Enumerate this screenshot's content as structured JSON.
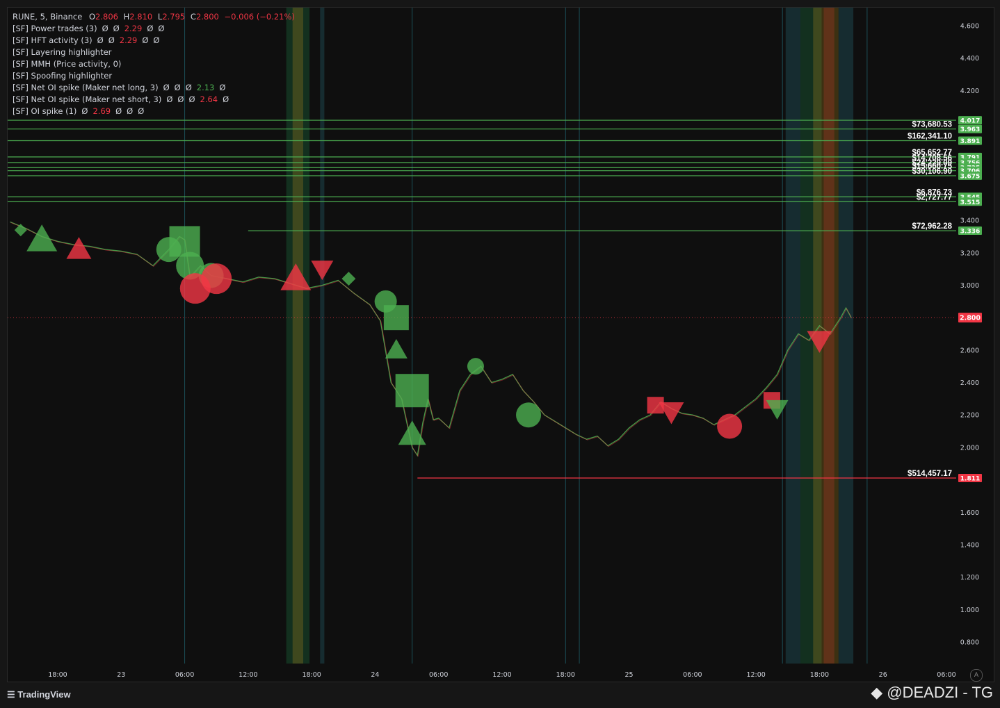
{
  "legend": {
    "symbol": "RUNE, 5, Binance",
    "o_label": "O",
    "o_val": "2.806",
    "h_label": "H",
    "h_val": "2.810",
    "l_label": "L",
    "l_val": "2.795",
    "c_label": "C",
    "c_val": "2.800",
    "change": "−0.006 (−0.21%)",
    "indicators": [
      {
        "name": "[SF] Power trades (3)",
        "parts": [
          [
            "Ø",
            "n"
          ],
          [
            "Ø",
            "n"
          ],
          [
            "2.29",
            "r"
          ],
          [
            "Ø",
            "n"
          ],
          [
            "Ø",
            "n"
          ]
        ]
      },
      {
        "name": "[SF] HFT activity (3)",
        "parts": [
          [
            "Ø",
            "n"
          ],
          [
            "Ø",
            "n"
          ],
          [
            "2.29",
            "r"
          ],
          [
            "Ø",
            "n"
          ],
          [
            "Ø",
            "n"
          ]
        ]
      },
      {
        "name": "[SF] Layering highlighter",
        "parts": []
      },
      {
        "name": "[SF] MMH (Price activity, 0)",
        "parts": []
      },
      {
        "name": "[SF] Spoofing highlighter",
        "parts": []
      },
      {
        "name": "[SF] Net OI spike (Maker net long, 3)",
        "parts": [
          [
            "Ø",
            "n"
          ],
          [
            "Ø",
            "n"
          ],
          [
            "Ø",
            "n"
          ],
          [
            "2.13",
            "g"
          ],
          [
            "Ø",
            "n"
          ]
        ]
      },
      {
        "name": "[SF] Net OI spike (Maker net short, 3)",
        "parts": [
          [
            "Ø",
            "n"
          ],
          [
            "Ø",
            "n"
          ],
          [
            "Ø",
            "n"
          ],
          [
            "2.64",
            "r"
          ],
          [
            "Ø",
            "n"
          ]
        ]
      },
      {
        "name": "[SF] OI spike (1)",
        "parts": [
          [
            "Ø",
            "n"
          ],
          [
            "2.69",
            "r"
          ],
          [
            "Ø",
            "n"
          ],
          [
            "Ø",
            "n"
          ],
          [
            "Ø",
            "n"
          ]
        ]
      }
    ]
  },
  "chart_data": {
    "type": "line",
    "symbol": "RUNE",
    "interval": "5",
    "exchange": "Binance",
    "ylim": [
      0.7,
      4.75
    ],
    "y_ticks": [
      "4.600",
      "4.400",
      "4.200",
      "3.400",
      "3.200",
      "3.000",
      "2.600",
      "2.400",
      "2.200",
      "2.000",
      "1.600",
      "1.400",
      "1.200",
      "1.000",
      "0.800"
    ],
    "x_ticks": [
      {
        "label": "18:00",
        "t": -6
      },
      {
        "label": "23",
        "t": 0
      },
      {
        "label": "06:00",
        "t": 6
      },
      {
        "label": "12:00",
        "t": 12
      },
      {
        "label": "18:00",
        "t": 18
      },
      {
        "label": "24",
        "t": 24
      },
      {
        "label": "06:00",
        "t": 30
      },
      {
        "label": "12:00",
        "t": 36
      },
      {
        "label": "18:00",
        "t": 42
      },
      {
        "label": "25",
        "t": 48
      },
      {
        "label": "06:00",
        "t": 54
      },
      {
        "label": "12:00",
        "t": 60
      },
      {
        "label": "18:00",
        "t": 66
      },
      {
        "label": "26",
        "t": 72
      },
      {
        "label": "06:00",
        "t": 78
      }
    ],
    "price_series": {
      "t": [
        -10.5,
        -9,
        -7.5,
        -6,
        -4.5,
        -3,
        -1.5,
        0,
        1.5,
        3,
        4.5,
        5.5,
        6,
        6.5,
        7.5,
        8.5,
        10,
        11.5,
        13,
        14.5,
        16,
        17.5,
        19,
        20.5,
        22,
        23.5,
        24.5,
        25.5,
        26.5,
        27.5,
        28,
        28.5,
        29,
        29.5,
        30,
        31,
        32,
        33,
        34,
        35,
        36,
        37,
        38,
        39,
        40,
        41,
        42,
        43,
        44,
        45,
        46,
        47,
        48,
        49,
        50,
        51,
        52,
        53,
        54,
        55,
        56,
        57,
        58,
        59,
        60,
        61,
        62,
        63,
        64,
        65,
        66,
        67,
        68,
        68.5,
        69
      ],
      "close": [
        3.39,
        3.35,
        3.3,
        3.27,
        3.25,
        3.24,
        3.22,
        3.21,
        3.19,
        3.12,
        3.22,
        3.3,
        3.28,
        3.05,
        3.12,
        3.06,
        3.04,
        3.02,
        3.05,
        3.04,
        3.01,
        2.98,
        3.0,
        3.03,
        2.95,
        2.88,
        2.78,
        2.4,
        2.3,
        2.0,
        1.95,
        2.15,
        2.3,
        2.17,
        2.18,
        2.12,
        2.35,
        2.45,
        2.5,
        2.4,
        2.42,
        2.45,
        2.35,
        2.28,
        2.2,
        2.16,
        2.12,
        2.08,
        2.05,
        2.07,
        2.01,
        2.05,
        2.12,
        2.17,
        2.2,
        2.28,
        2.24,
        2.21,
        2.2,
        2.18,
        2.14,
        2.17,
        2.2,
        2.25,
        2.3,
        2.37,
        2.45,
        2.6,
        2.7,
        2.66,
        2.75,
        2.7,
        2.8,
        2.86,
        2.8
      ],
      "color": "#4caf50"
    },
    "current_price": {
      "value": 2.8,
      "label": "2.800",
      "color": "#f23645"
    },
    "levels": [
      {
        "price": 4.017,
        "label": "4.017",
        "amount": "",
        "color": "#4caf50",
        "t_start": null
      },
      {
        "price": 3.963,
        "label": "3.963",
        "amount": "$73,680.53",
        "color": "#4caf50",
        "t_start": null
      },
      {
        "price": 3.891,
        "label": "3.891",
        "amount": "$162,341.10",
        "color": "#4caf50",
        "t_start": null
      },
      {
        "price": 3.791,
        "label": "3.791",
        "amount": "$65,652.77",
        "color": "#4caf50",
        "t_start": null
      },
      {
        "price": 3.756,
        "label": "3.756",
        "amount": "$14,708.56",
        "color": "#4caf50",
        "t_start": null
      },
      {
        "price": 3.725,
        "label": "3.725",
        "amount": "$24,229.09",
        "color": "#4caf50",
        "t_start": null
      },
      {
        "price": 3.706,
        "label": "3.706",
        "amount": "$15,660.75",
        "color": "#4caf50",
        "t_start": null
      },
      {
        "price": 3.675,
        "label": "3.675",
        "amount": "$30,106.90",
        "color": "#4caf50",
        "t_start": null
      },
      {
        "price": 3.545,
        "label": "3.545",
        "amount": "$6,876.73",
        "color": "#4caf50",
        "t_start": null
      },
      {
        "price": 3.515,
        "label": "3.515",
        "amount": "$2,727.77",
        "color": "#4caf50",
        "t_start": null
      },
      {
        "price": 3.336,
        "label": "3.336",
        "amount": "$72,962.28",
        "color": "#4caf50",
        "t_start": 12
      },
      {
        "price": 1.811,
        "label": "1.811",
        "amount": "$514,457.17",
        "color": "#f23645",
        "t_start": 28
      }
    ],
    "markers": [
      {
        "shape": "diamond",
        "t": -9.5,
        "price": 3.34,
        "color": "#4caf50",
        "size": 9
      },
      {
        "shape": "triangle-up",
        "t": -7.5,
        "price": 3.28,
        "color": "#4caf50",
        "size": 22
      },
      {
        "shape": "triangle-up",
        "t": -4.0,
        "price": 3.22,
        "color": "#f23645",
        "size": 18
      },
      {
        "shape": "circle",
        "t": 4.5,
        "price": 3.22,
        "color": "#4caf50",
        "size": 18
      },
      {
        "shape": "square",
        "t": 6.0,
        "price": 3.27,
        "color": "#4caf50",
        "size": 22
      },
      {
        "shape": "circle",
        "t": 6.5,
        "price": 3.12,
        "color": "#4caf50",
        "size": 20
      },
      {
        "shape": "circle",
        "t": 8.5,
        "price": 3.06,
        "color": "#4caf50",
        "size": 18
      },
      {
        "shape": "circle",
        "t": 7.0,
        "price": 2.98,
        "color": "#f23645",
        "size": 22
      },
      {
        "shape": "circle",
        "t": 9.0,
        "price": 3.04,
        "color": "#f23645",
        "size": 22
      },
      {
        "shape": "triangle-up",
        "t": 16.5,
        "price": 3.04,
        "color": "#f23645",
        "size": 22
      },
      {
        "shape": "triangle-down",
        "t": 19.0,
        "price": 3.1,
        "color": "#f23645",
        "size": 16
      },
      {
        "shape": "diamond",
        "t": 21.5,
        "price": 3.04,
        "color": "#4caf50",
        "size": 10
      },
      {
        "shape": "circle",
        "t": 25.0,
        "price": 2.9,
        "color": "#4caf50",
        "size": 16
      },
      {
        "shape": "square",
        "t": 26.0,
        "price": 2.8,
        "color": "#4caf50",
        "size": 18
      },
      {
        "shape": "triangle-up",
        "t": 26.0,
        "price": 2.6,
        "color": "#4caf50",
        "size": 16
      },
      {
        "shape": "square",
        "t": 27.5,
        "price": 2.35,
        "color": "#4caf50",
        "size": 24
      },
      {
        "shape": "triangle-up",
        "t": 27.5,
        "price": 2.08,
        "color": "#4caf50",
        "size": 20
      },
      {
        "shape": "circle",
        "t": 33.5,
        "price": 2.5,
        "color": "#4caf50",
        "size": 12
      },
      {
        "shape": "circle",
        "t": 38.5,
        "price": 2.2,
        "color": "#4caf50",
        "size": 18
      },
      {
        "shape": "square",
        "t": 50.5,
        "price": 2.26,
        "color": "#f23645",
        "size": 12
      },
      {
        "shape": "triangle-down",
        "t": 52.0,
        "price": 2.22,
        "color": "#f23645",
        "size": 18
      },
      {
        "shape": "circle",
        "t": 57.5,
        "price": 2.13,
        "color": "#f23645",
        "size": 18
      },
      {
        "shape": "square",
        "t": 61.5,
        "price": 2.29,
        "color": "#f23645",
        "size": 12
      },
      {
        "shape": "triangle-down",
        "t": 62.0,
        "price": 2.24,
        "color": "#4caf50",
        "size": 16
      },
      {
        "shape": "triangle-down",
        "t": 66.0,
        "price": 2.66,
        "color": "#f23645",
        "size": 18
      }
    ],
    "bands": [
      {
        "t0": 15.6,
        "t1": 17.8,
        "color": "#1f8a4c"
      },
      {
        "t0": 16.2,
        "t1": 17.2,
        "color": "#b58a1e"
      },
      {
        "t0": 18.8,
        "t1": 19.2,
        "color": "#2a7a8a"
      },
      {
        "t0": 62.8,
        "t1": 64.2,
        "color": "#2a7a8a"
      },
      {
        "t0": 64.2,
        "t1": 66.2,
        "color": "#1f8a4c"
      },
      {
        "t0": 65.4,
        "t1": 67.8,
        "color": "#b58a1e"
      },
      {
        "t0": 66.4,
        "t1": 67.4,
        "color": "#c0392b"
      },
      {
        "t0": 67.8,
        "t1": 69.2,
        "color": "#2a7a8a"
      }
    ],
    "vlines": [
      6,
      27.5,
      42,
      43.3,
      62.5,
      70.5
    ],
    "colors": {
      "background": "#0f0f0f",
      "text": "#d1d4dc",
      "up": "#4caf50",
      "down": "#f23645"
    }
  },
  "footer": {
    "logo": "TradingView",
    "watermark": "@DEADZI - TG",
    "auto_label": "A"
  }
}
